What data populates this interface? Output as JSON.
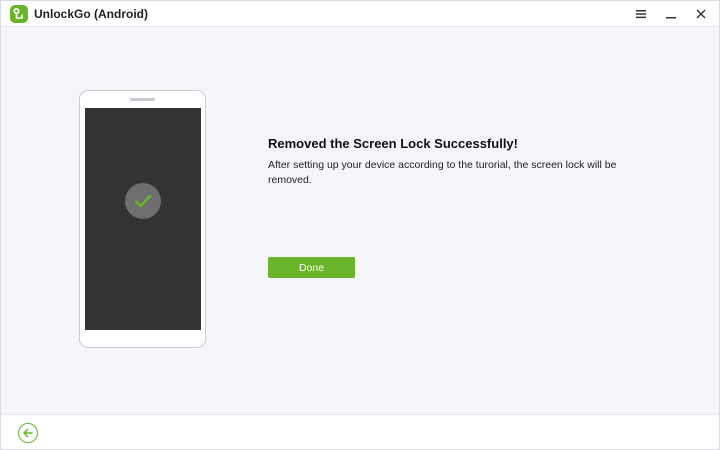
{
  "window": {
    "title": "UnlockGo (Android)",
    "controls": {
      "menu_icon": "hamburger-menu-icon",
      "minimize_icon": "minimize-icon",
      "close_icon": "close-icon"
    }
  },
  "main": {
    "title": "Removed the Screen Lock Successfully!",
    "description": "After setting up your device according to the turorial, the screen lock will be removed.",
    "done_label": "Done",
    "status_icon": "checkmark-icon"
  },
  "footer": {
    "back_icon": "back-arrow-icon"
  },
  "colors": {
    "accent": "#6ab42a",
    "content_bg": "#f5f6f9",
    "phone_screen": "#333333",
    "check_badge": "#6e6e6e"
  }
}
